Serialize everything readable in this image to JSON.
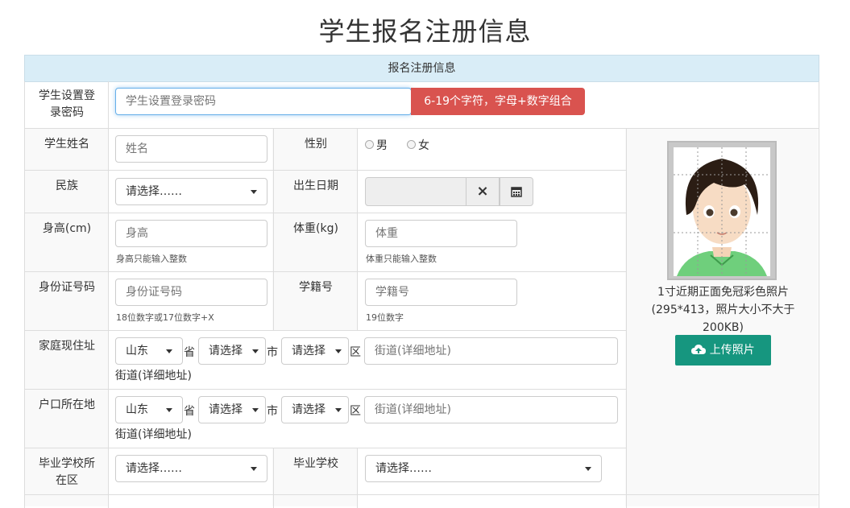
{
  "page_title": "学生报名注册信息",
  "section_header": "报名注册信息",
  "password": {
    "label_line1": "学生设置登",
    "label_line2": "录密码",
    "placeholder": "学生设置登录密码",
    "hint_button": "6-19个字符，字母+数字组合"
  },
  "name": {
    "label": "学生姓名",
    "placeholder": "姓名"
  },
  "gender": {
    "label": "性别",
    "option_male": "男",
    "option_female": "女"
  },
  "ethnicity": {
    "label": "民族",
    "value": "请选择……"
  },
  "birth_date": {
    "label": "出生日期",
    "clear_icon": "×"
  },
  "height": {
    "label": "身高(cm)",
    "placeholder": "身高",
    "hint": "身高只能输入整数"
  },
  "weight": {
    "label": "体重(kg)",
    "placeholder": "体重",
    "hint": "体重只能输入整数"
  },
  "id_number": {
    "label": "身份证号码",
    "placeholder": "身份证号码",
    "hint": "18位数字或17位数字+X"
  },
  "student_id": {
    "label": "学籍号",
    "placeholder": "学籍号",
    "hint": "19位数字"
  },
  "home_address": {
    "label": "家庭现住址",
    "province": "山东",
    "province_suffix": "省",
    "city": "请选择",
    "city_suffix": "市",
    "district": "请选择",
    "district_suffix": "区",
    "street_placeholder": "街道(详细地址)",
    "street_text": "街道(详细地址)"
  },
  "hukou_address": {
    "label": "户口所在地",
    "province": "山东",
    "province_suffix": "省",
    "city": "请选择",
    "city_suffix": "市",
    "district": "请选择",
    "district_suffix": "区",
    "street_placeholder": "街道(详细地址)",
    "street_text": "街道(详细地址)"
  },
  "school_area": {
    "label_line1": "毕业学校所",
    "label_line2": "在区",
    "value": "请选择……"
  },
  "school": {
    "label": "毕业学校",
    "value": "请选择……"
  },
  "photo": {
    "caption_line1": "1寸近期正面免冠彩色照片",
    "caption_line2": "(295*413，照片大小不大于",
    "caption_line3": "200KB)",
    "upload_label": "上传照片"
  },
  "colors": {
    "danger": "#d9534f",
    "upload": "#16967f",
    "header_band": "#d9edf7"
  }
}
